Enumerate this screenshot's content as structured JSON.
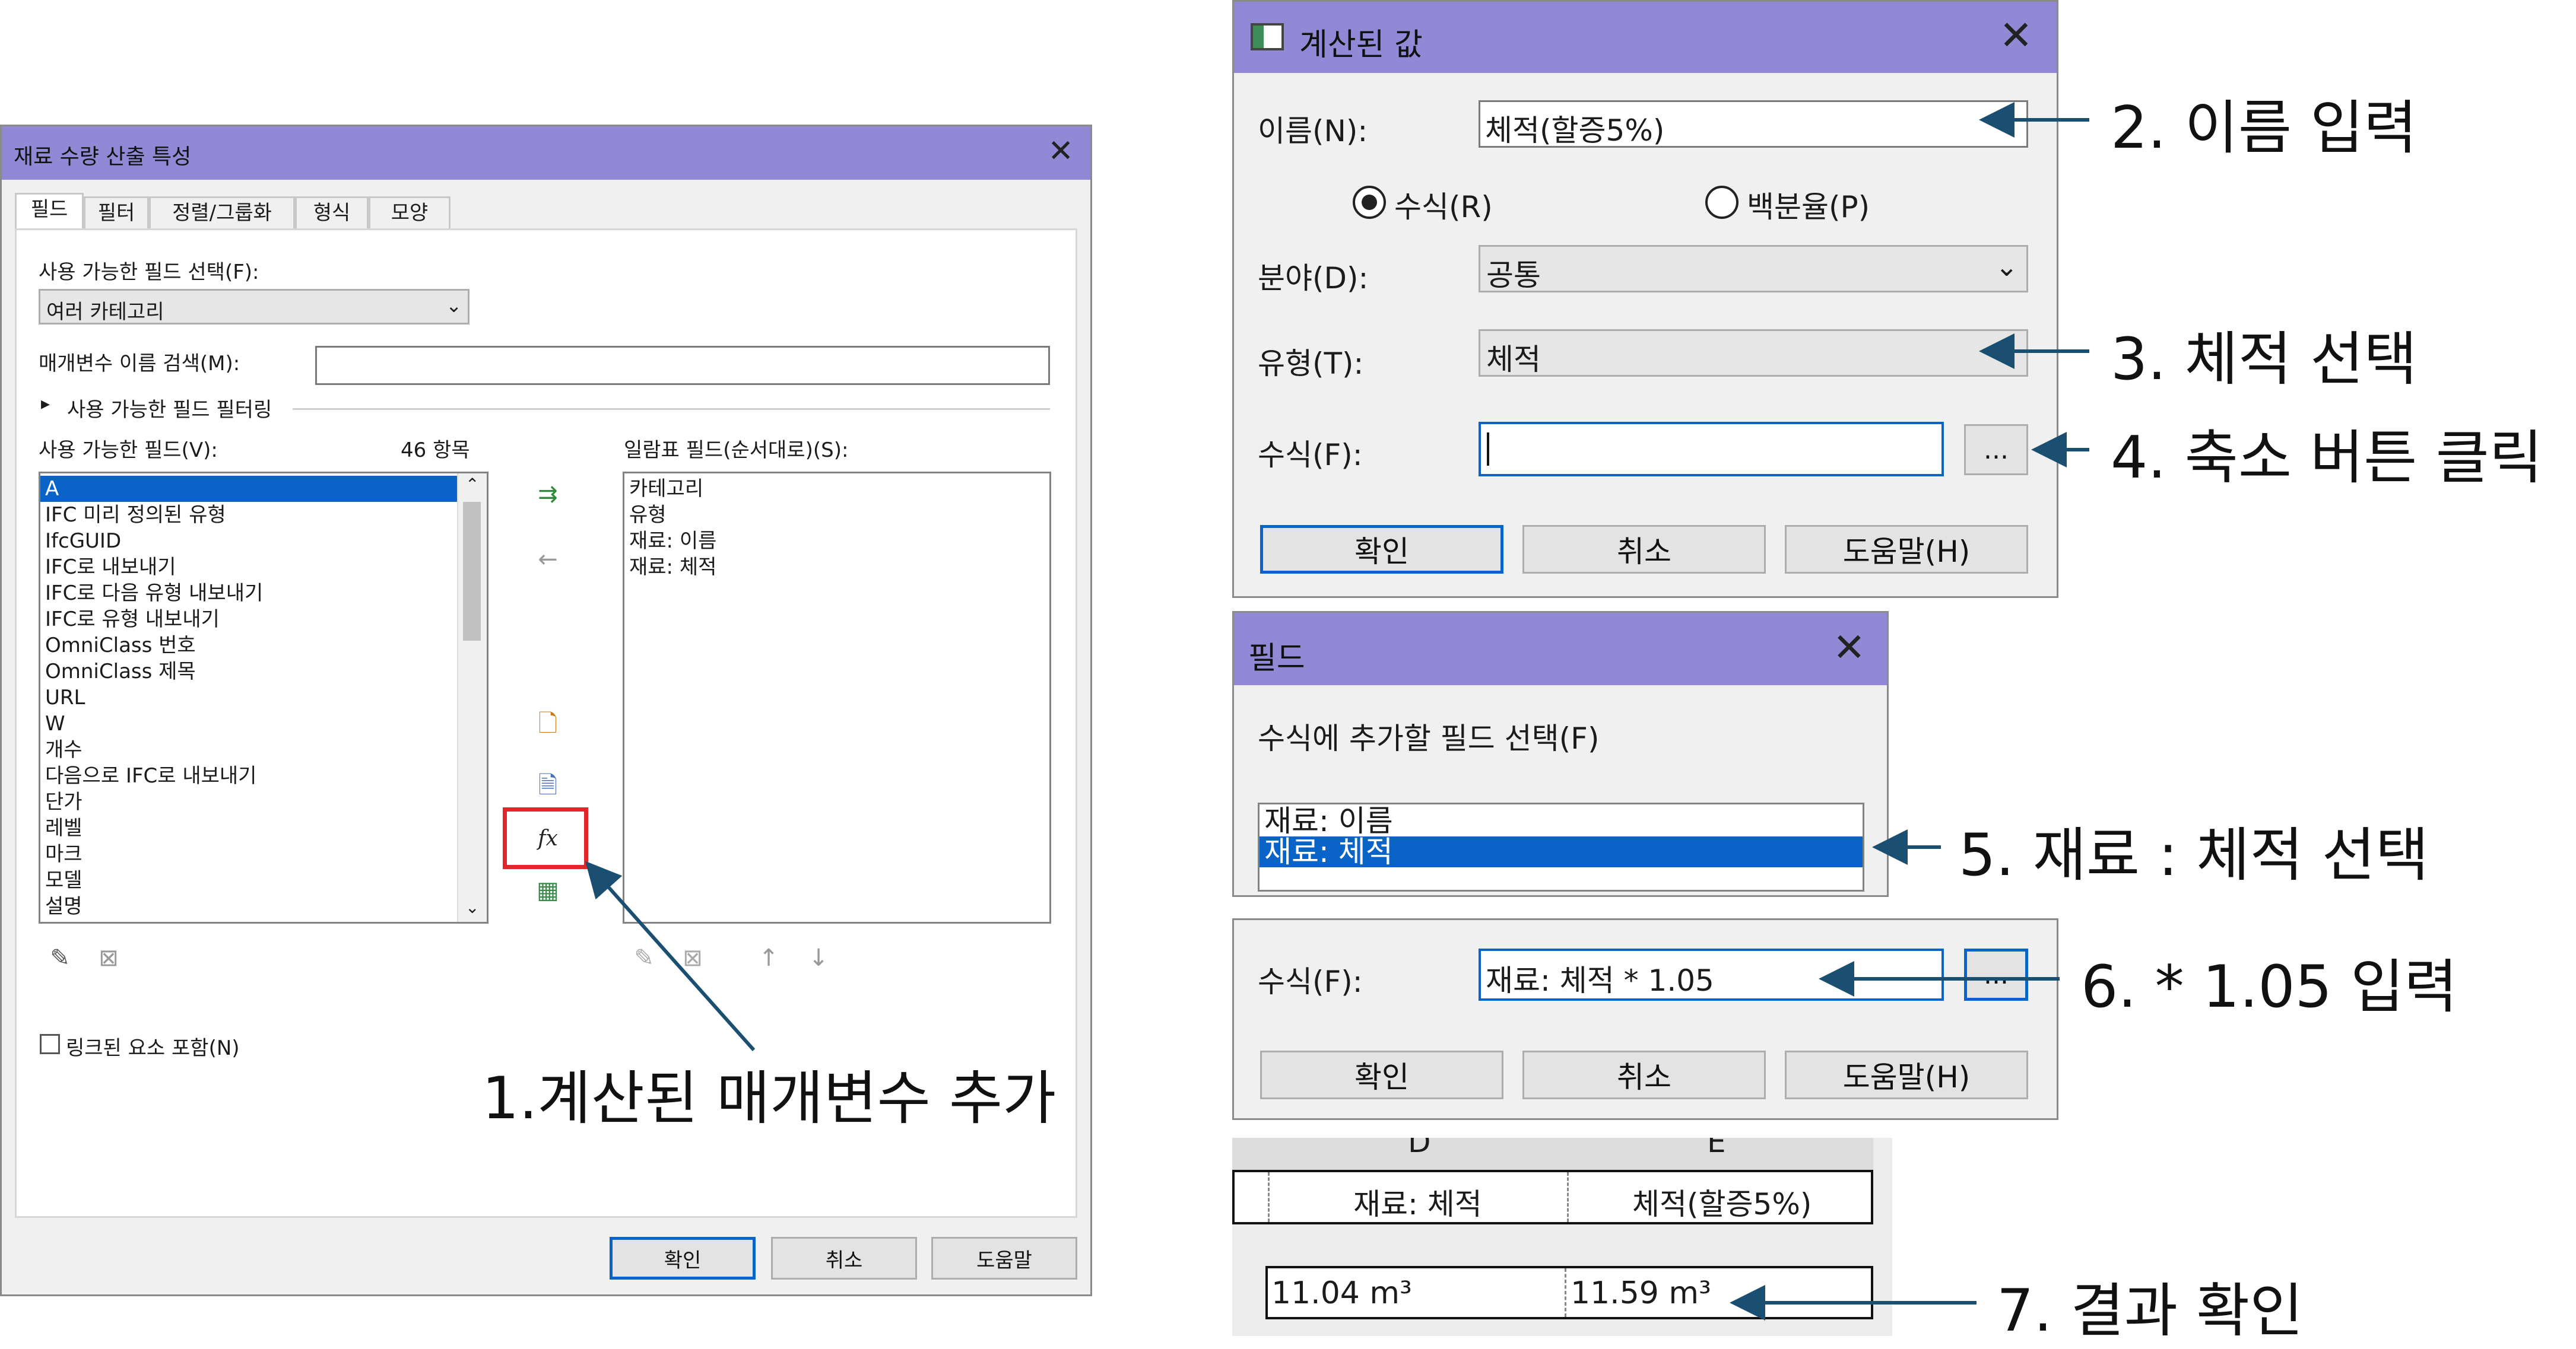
{
  "main_dialog": {
    "title": "재료 수량 산출 특성",
    "tabs": [
      "필드",
      "필터",
      "정렬/그룹화",
      "형식",
      "모양"
    ],
    "select_label": "사용 가능한 필드 선택(F):",
    "category_value": "여러 카테고리",
    "search_label": "매개변수 이름 검색(M):",
    "search_value": "",
    "filter_label": "사용 가능한 필드 필터링",
    "available_label": "사용 가능한 필드(V):",
    "count_label": "46 항목",
    "schedule_label": "일람표 필드(순서대로)(S):",
    "available_fields": [
      "A",
      "IFC 미리 정의된 유형",
      "IfcGUID",
      "IFC로 내보내기",
      "IFC로 다음 유형 내보내기",
      "IFC로 유형 내보내기",
      "OmniClass 번호",
      "OmniClass 제목",
      "URL",
      "W",
      "개수",
      "다음으로 IFC로 내보내기",
      "단가",
      "레벨",
      "마크",
      "모델",
      "설명"
    ],
    "schedule_fields": [
      "카테고리",
      "유형",
      "재료: 이름",
      "재료: 체적"
    ],
    "include_linked": "링크된 요소 포함(N)",
    "ok": "확인",
    "cancel": "취소",
    "help": "도움말"
  },
  "calc_dialog": {
    "title": "계산된 값",
    "name_label": "이름(N):",
    "name_value": "체적(할증5%)",
    "radio_formula": "수식(R)",
    "radio_percent": "백분율(P)",
    "discipline_label": "분야(D):",
    "discipline_value": "공통",
    "type_label": "유형(T):",
    "type_value": "체적",
    "formula_label": "수식(F):",
    "formula_value": "",
    "ellipsis": "...",
    "ok": "확인",
    "cancel": "취소",
    "help": "도움말(H)"
  },
  "field_dialog": {
    "title": "필드",
    "prompt": "수식에 추가할 필드 선택(F)",
    "items": [
      "재료: 이름",
      "재료: 체적"
    ]
  },
  "formula_panel": {
    "label": "수식(F):",
    "value": "재료: 체적 * 1.05",
    "ellipsis": "...",
    "ok": "확인",
    "cancel": "취소",
    "help": "도움말(H)"
  },
  "result_table": {
    "col_d": "D",
    "col_e": "E",
    "header_d": "재료: 체적",
    "header_e": "체적(할증5%)",
    "value_d": "11.04 m³",
    "value_e": "11.59 m³"
  },
  "captions": {
    "step1": "1.계산된 매개변수 추가",
    "step2": "2. 이름 입력",
    "step3": "3. 체적 선택",
    "step4": "4. 축소 버튼 클릭",
    "step5": "5. 재료 : 체적 선택",
    "step6": "6. * 1.05 입력",
    "step7": "7. 결과 확인"
  },
  "colors": {
    "titlebar": "#9189d6",
    "selection": "#0a64c8",
    "highlight_box": "#e0262b",
    "arrow": "#1b4f72"
  }
}
